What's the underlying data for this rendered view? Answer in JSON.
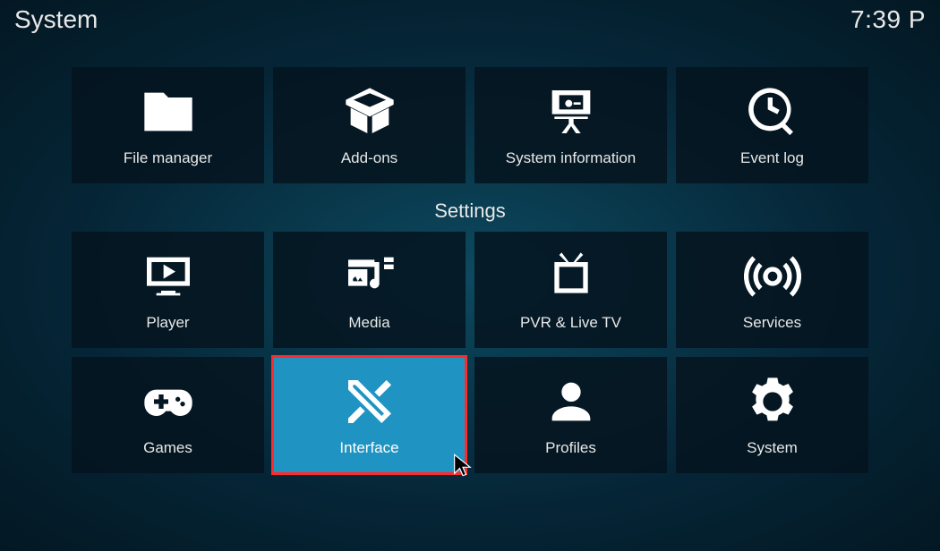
{
  "header": {
    "title": "System",
    "time": "7:39 P"
  },
  "section_title": "Settings",
  "row1": [
    {
      "id": "file-manager",
      "label": "File manager"
    },
    {
      "id": "add-ons",
      "label": "Add-ons"
    },
    {
      "id": "system-information",
      "label": "System information"
    },
    {
      "id": "event-log",
      "label": "Event log"
    }
  ],
  "row2": [
    {
      "id": "player",
      "label": "Player"
    },
    {
      "id": "media",
      "label": "Media"
    },
    {
      "id": "pvr-live-tv",
      "label": "PVR & Live TV"
    },
    {
      "id": "services",
      "label": "Services"
    }
  ],
  "row3": [
    {
      "id": "games",
      "label": "Games"
    },
    {
      "id": "interface",
      "label": "Interface",
      "active": true
    },
    {
      "id": "profiles",
      "label": "Profiles"
    },
    {
      "id": "system",
      "label": "System"
    }
  ]
}
